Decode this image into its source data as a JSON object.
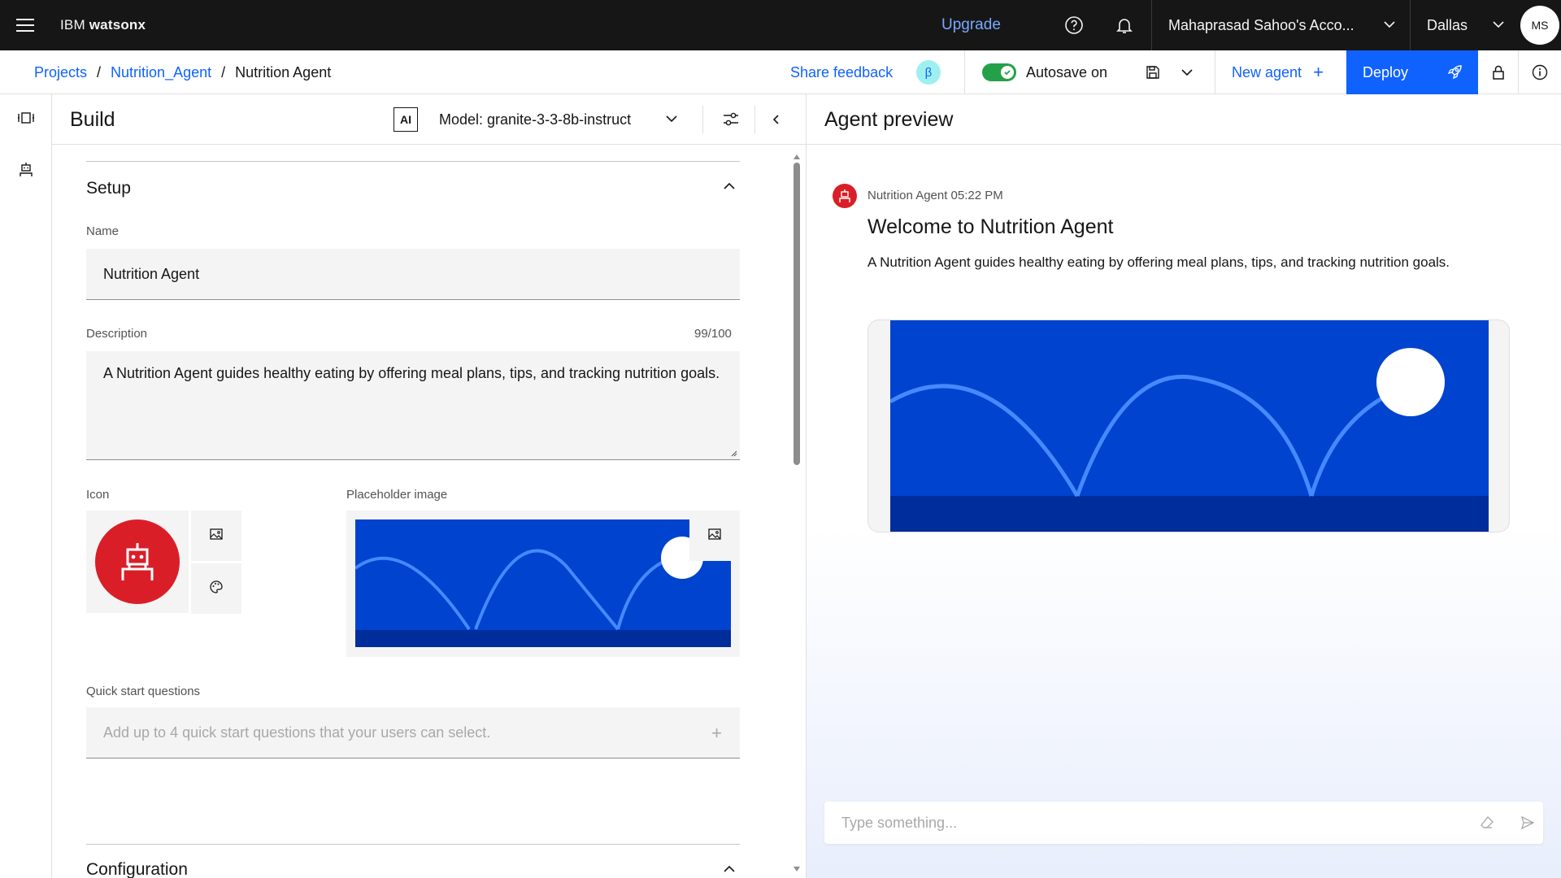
{
  "header": {
    "brand_prefix": "IBM ",
    "brand_name": "watsonx",
    "upgrade_label": "Upgrade",
    "account_label": "Mahaprasad Sahoo's Acco...",
    "region_label": "Dallas",
    "avatar_initials": "MS"
  },
  "subbar": {
    "breadcrumbs": [
      "Projects",
      "Nutrition_Agent",
      "Nutrition Agent"
    ],
    "share_feedback": "Share feedback",
    "beta_badge": "β",
    "autosave_label": "Autosave on",
    "new_agent_label": "New agent",
    "deploy_label": "Deploy"
  },
  "build": {
    "title": "Build",
    "ai_badge": "AI",
    "model_label": "Model: granite-3-3-8b-instruct",
    "setup_title": "Setup",
    "name_label": "Name",
    "name_value": "Nutrition Agent",
    "description_label": "Description",
    "description_counter": "99/100",
    "description_value": "A Nutrition Agent guides healthy eating by offering meal plans, tips, and tracking nutrition goals.",
    "icon_label": "Icon",
    "placeholder_image_label": "Placeholder image",
    "quick_start_label": "Quick start questions",
    "quick_start_placeholder": "Add up to 4 quick start questions that your users can select.",
    "configuration_title": "Configuration"
  },
  "preview": {
    "title": "Agent preview",
    "message_meta": "Nutrition Agent 05:22 PM",
    "message_title": "Welcome to Nutrition Agent",
    "message_text": "A Nutrition Agent guides healthy eating by offering meal plans, tips, and tracking nutrition goals.",
    "input_placeholder": "Type something..."
  },
  "colors": {
    "header_bg": "#161616",
    "accent": "#0f62fe",
    "agent_icon": "#da1e28",
    "toggle_on": "#24a148",
    "placeholder_image_bg": "#0043ce"
  },
  "icons": {
    "menu": "hamburger-icon",
    "help": "help-icon",
    "notifications": "bell-icon",
    "save": "save-icon",
    "deploy": "rocket-icon",
    "lock": "lock-icon",
    "info": "info-icon",
    "agent": "robot-icon",
    "image": "image-icon",
    "palette": "palette-icon",
    "clear": "eraser-icon",
    "send": "send-icon"
  }
}
